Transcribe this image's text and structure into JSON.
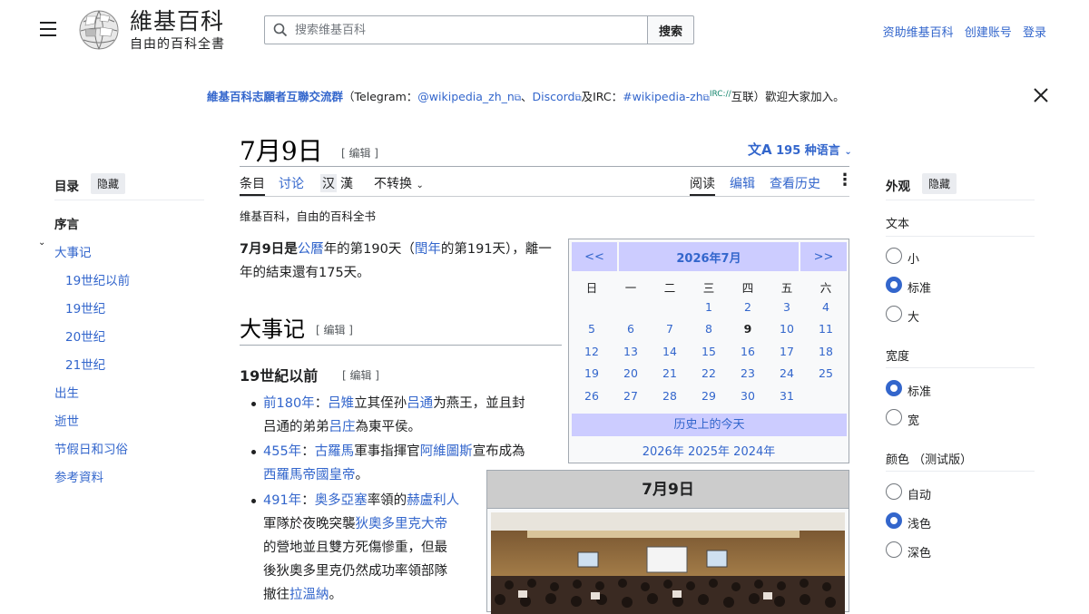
{
  "header": {
    "logo_title": "維基百科",
    "logo_tagline": "自由的百科全書",
    "search_placeholder": "搜索维基百科",
    "search_button": "搜索",
    "user_links": [
      "资助维基百科",
      "创建账号",
      "登录"
    ]
  },
  "banner": {
    "lead": "維基百科志願者互聯交流群",
    "t1": "（Telegram：",
    "l1": "@wikipedia_zh_n",
    "t2": "、",
    "l2": "Discord",
    "t3": "及IRC：",
    "l3": "#wikipedia-zh",
    "sup": "IRC://",
    "t4": "互联）歡迎大家加入。"
  },
  "page": {
    "title": "7月9日",
    "edit": "[ 编辑 ]",
    "lang_count": "195 种语言",
    "tagline": "维基百科，自由的百科全书"
  },
  "tabs": {
    "article": "条目",
    "talk": "讨论",
    "han1": "汉",
    "han2": "漢",
    "convert": "不转换",
    "read": "阅读",
    "edit": "编辑",
    "history": "查看历史"
  },
  "toc": {
    "title": "目录",
    "hide": "隐藏",
    "items": [
      "序言",
      "大事记",
      "19世纪以前",
      "19世纪",
      "20世纪",
      "21世纪",
      "出生",
      "逝世",
      "节假日和习俗",
      "参考資料"
    ]
  },
  "content": {
    "intro_a": "7月9日",
    "intro_b": "是",
    "intro_c": "公曆",
    "intro_d": "年的第190天（",
    "intro_e": "閏年",
    "intro_f": "的第191天），離一年的結束還有175天。",
    "h2": "大事记",
    "h2_edit": "[ 编辑 ]",
    "h3": "19世紀以前",
    "h3_edit": "[ 编辑 ]",
    "b1_year": "前180年",
    "b1_c": "：",
    "b1_l1": "吕雉",
    "b1_t1": "立其侄孙",
    "b1_l2": "吕通",
    "b1_t2": "为燕王，並且封",
    "b1_t3": "吕通的弟弟",
    "b1_l3": "吕庄",
    "b1_t4": "為東平侯。",
    "b2_year": "455年",
    "b2_c": "：",
    "b2_l1": "古羅馬",
    "b2_t1": "軍事指揮官",
    "b2_l2": "阿維圖斯",
    "b2_t2": "宣布成為",
    "b2_l3": "西羅馬帝國皇帝",
    "b2_t3": "。",
    "b3_year": "491年",
    "b3_c": "：",
    "b3_l1": "奥多亞塞",
    "b3_t1": "率領的",
    "b3_l2": "赫盧利人",
    "b3_t2": "軍隊於夜晚突襲",
    "b3_l3": "狄奧多里克大帝",
    "b3_t3": "的營地並且雙方死傷慘重，但最",
    "b3_t4": "後狄奧多里克仍然成功率領部隊",
    "b3_t5": "撤往",
    "b3_l4": "拉溫納",
    "b3_t6": "。"
  },
  "calendar": {
    "prev": "<<",
    "month": "2026年7月",
    "next": ">>",
    "weekdays": [
      "日",
      "一",
      "二",
      "三",
      "四",
      "五",
      "六"
    ],
    "today_link": "历史上的今天",
    "years": "2026年 2025年 2024年"
  },
  "infobox": {
    "title": "7月9日"
  },
  "appearance": {
    "title": "外观",
    "hide": "隐藏",
    "text_label": "文本",
    "text_opts": [
      "小",
      "标准",
      "大"
    ],
    "width_label": "宽度",
    "width_opts": [
      "标准",
      "宽"
    ],
    "color_label": "颜色 （测试版）",
    "color_opts": [
      "自动",
      "浅色",
      "深色"
    ],
    "text_selected": 1,
    "width_selected": 0,
    "color_selected": 1
  }
}
